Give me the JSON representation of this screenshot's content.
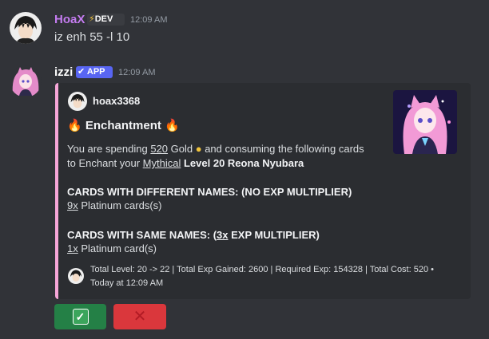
{
  "messages": [
    {
      "username": "HoaX",
      "badge": "DEV",
      "badge_icon": "lightning-icon",
      "timestamp": "12:09 AM",
      "content": "iz enh 55 -l 10"
    },
    {
      "username": "izzi",
      "badge": "APP",
      "badge_icon": "check-icon",
      "timestamp": "12:09 AM"
    }
  ],
  "embed": {
    "accent_color": "#f6a6d8",
    "author": "hoax3368",
    "title": "Enchantment",
    "title_icons": [
      "fire-icon",
      "fire-icon"
    ],
    "line1": {
      "prefix": "You are spending ",
      "amount": "520",
      "mid": " Gold ",
      "suffix": " and consuming the following cards"
    },
    "line2": {
      "prefix": "to Enchant your ",
      "rarity": "Mythical",
      "card": "Level 20 Reona Nyubara"
    },
    "section1": {
      "heading": "CARDS WITH DIFFERENT NAMES: (NO EXP MULTIPLIER)",
      "count": "9x",
      "label": " Platinum cards(s)"
    },
    "section2": {
      "heading_prefix": "CARDS WITH SAME NAMES: (",
      "multiplier": "3x",
      "heading_suffix": " EXP MULTIPLIER)",
      "count": "1x",
      "label": " Platinum card(s)"
    },
    "footer": {
      "line1": "Total Level: 20 -> 22 | Total Exp Gained: 2600 | Required Exp: 154328 | Total Cost: 520 •",
      "line2": "Today at 12:09 AM"
    }
  },
  "buttons": {
    "confirm_icon": "checkmark-icon",
    "confirm_glyph": "✓",
    "cancel_icon": "x-icon",
    "cancel_glyph": "✕",
    "confirm_color": "#248046",
    "cancel_color": "#da373c"
  }
}
